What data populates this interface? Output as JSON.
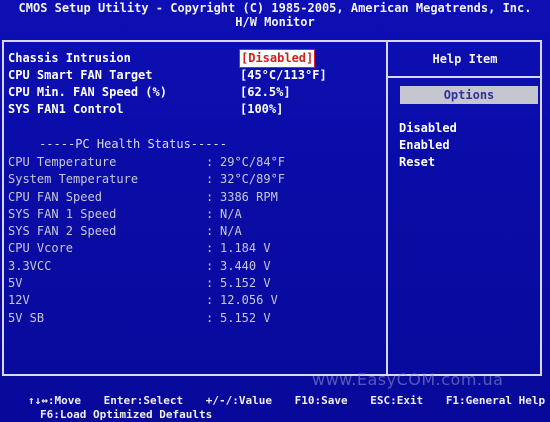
{
  "header": {
    "line1": "CMOS Setup Utility - Copyright (C) 1985-2005, American Megatrends, Inc.",
    "line2": "H/W Monitor"
  },
  "settings": [
    {
      "label": "Chassis Intrusion",
      "value": "[Disabled]"
    },
    {
      "label": "CPU Smart FAN Target",
      "value": "[45°C/113°F]"
    },
    {
      "label": "CPU Min. FAN Speed (%)",
      "value": "[62.5%]"
    },
    {
      "label": "SYS FAN1 Control",
      "value": "[100%]"
    }
  ],
  "health": {
    "title": "-----PC Health Status-----",
    "items": [
      {
        "label": "CPU Temperature",
        "value": "29°C/84°F"
      },
      {
        "label": "System Temperature",
        "value": "32°C/89°F"
      },
      {
        "label": "CPU FAN Speed",
        "value": "3386 RPM"
      },
      {
        "label": "SYS FAN 1 Speed",
        "value": "N/A"
      },
      {
        "label": "SYS FAN 2 Speed",
        "value": "N/A"
      },
      {
        "label": "CPU Vcore",
        "value": "1.184 V"
      },
      {
        "label": "3.3VCC",
        "value": "3.440 V"
      },
      {
        "label": "5V",
        "value": "5.152 V"
      },
      {
        "label": "12V",
        "value": "12.056 V"
      },
      {
        "label": "5V SB",
        "value": "5.152 V"
      }
    ]
  },
  "help": {
    "title": "Help Item",
    "options_label": "Options",
    "options": [
      "Disabled",
      "Enabled",
      "Reset"
    ]
  },
  "watermark": "www.EasyCOM.com.ua",
  "footer": {
    "move": "Move",
    "select": "Enter:Select",
    "value": "+/-/:Value",
    "save": "F10:Save",
    "exit": "ESC:Exit",
    "help": "F1:General Help",
    "defaults": "F6:Load Optimized Defaults",
    "arrows_icon": "arrow-keys-icon"
  }
}
